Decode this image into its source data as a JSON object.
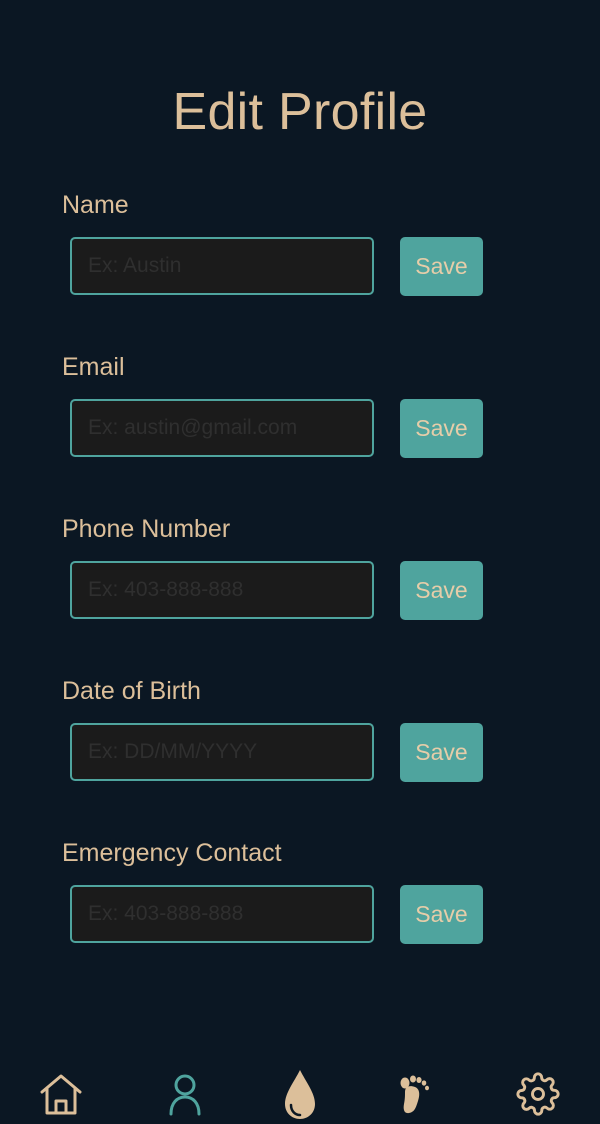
{
  "header": {
    "title": "Edit Profile"
  },
  "fields": [
    {
      "label": "Name",
      "placeholder": "Ex: Austin",
      "value": "",
      "save_label": "Save"
    },
    {
      "label": "Email",
      "placeholder": "Ex: austin@gmail.com",
      "value": "",
      "save_label": "Save"
    },
    {
      "label": "Phone Number",
      "placeholder": "Ex: 403-888-888",
      "value": "",
      "save_label": "Save"
    },
    {
      "label": "Date of Birth",
      "placeholder": "Ex: DD/MM/YYYY",
      "value": "",
      "save_label": "Save"
    },
    {
      "label": "Emergency Contact",
      "placeholder": "Ex: 403-888-888",
      "value": "",
      "save_label": "Save"
    }
  ],
  "bottom_nav": {
    "items": [
      {
        "icon": "home-icon",
        "active": false
      },
      {
        "icon": "profile-icon",
        "active": true
      },
      {
        "icon": "water-drop-icon",
        "active": false
      },
      {
        "icon": "footprint-icon",
        "active": false
      },
      {
        "icon": "gear-icon",
        "active": false
      }
    ]
  },
  "colors": {
    "background": "#0b1723",
    "accent_teal": "#4fa49e",
    "text_tan": "#dcbf9a",
    "input_background": "#1b1b1b"
  }
}
